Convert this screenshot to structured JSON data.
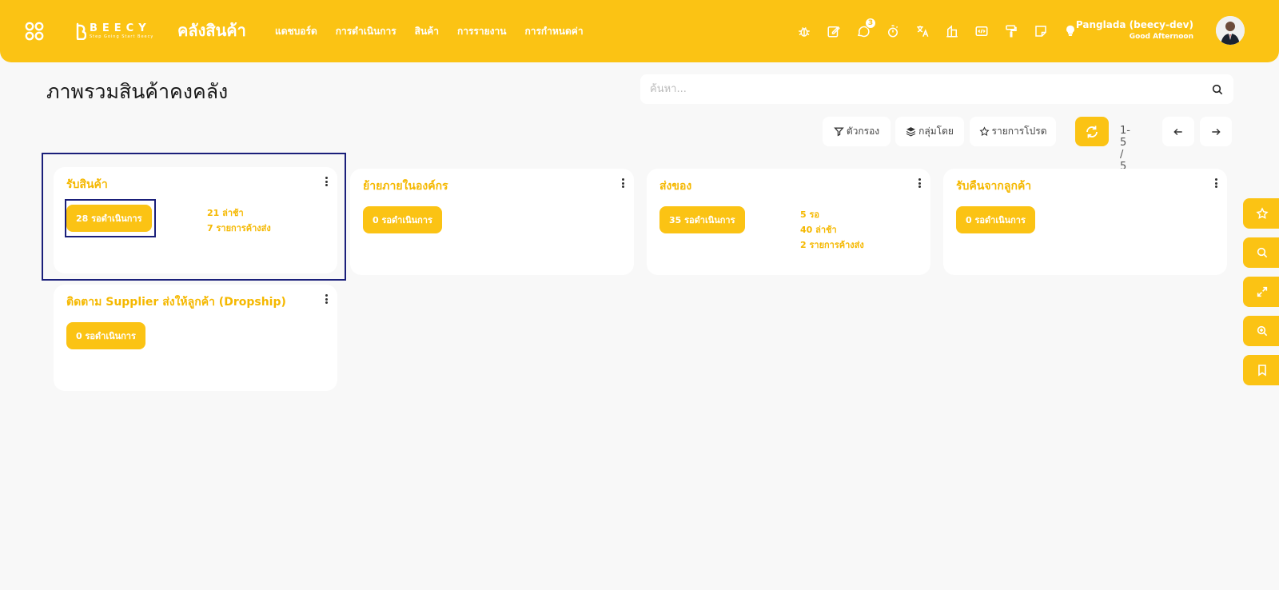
{
  "header": {
    "app_title": "คลังสินค้า",
    "logo_word": "BEECY",
    "logo_tag": "Step Going Start Beecy",
    "nav": [
      "แดชบอร์ด",
      "การดำเนินการ",
      "สินค้า",
      "การรายงาน",
      "การกำหนดค่า"
    ],
    "chat_badge": "3",
    "user_name": "Panglada (beecy-dev)",
    "greeting": "Good Afternoon",
    "accent_color": "#fbc314"
  },
  "page": {
    "title": "ภาพรวมสินค้าคงคลัง",
    "search_placeholder": "ค้นหา...",
    "filters": {
      "filter_label": "ตัวกรอง",
      "group_label": "กลุ่มโดย",
      "favorites_label": "รายการโปรด"
    },
    "pager": "1-5 / 5"
  },
  "cards": [
    {
      "title": "รับสินค้า",
      "pill": "28 รอดำเนินการ",
      "stats": [
        "21 ล่าช้า",
        "7 รายการค้างส่ง"
      ]
    },
    {
      "title": "ย้ายภายในองค์กร",
      "pill": "0 รอดำเนินการ",
      "stats": []
    },
    {
      "title": "ส่งของ",
      "pill": "35 รอดำเนินการ",
      "stats": [
        "5 รอ",
        "40 ล่าช้า",
        "2 รายการค้างส่ง"
      ]
    },
    {
      "title": "รับคืนจากลูกค้า",
      "pill": "0 รอดำเนินการ",
      "stats": []
    },
    {
      "title": "ติดตาม Supplier ส่งให้ลูกค้า (Dropship)",
      "pill": "0 รอดำเนินการ",
      "stats": []
    }
  ],
  "side_buttons": [
    "star-icon",
    "search-icon",
    "expand-icon",
    "zoom-in-icon",
    "bookmark-icon"
  ]
}
